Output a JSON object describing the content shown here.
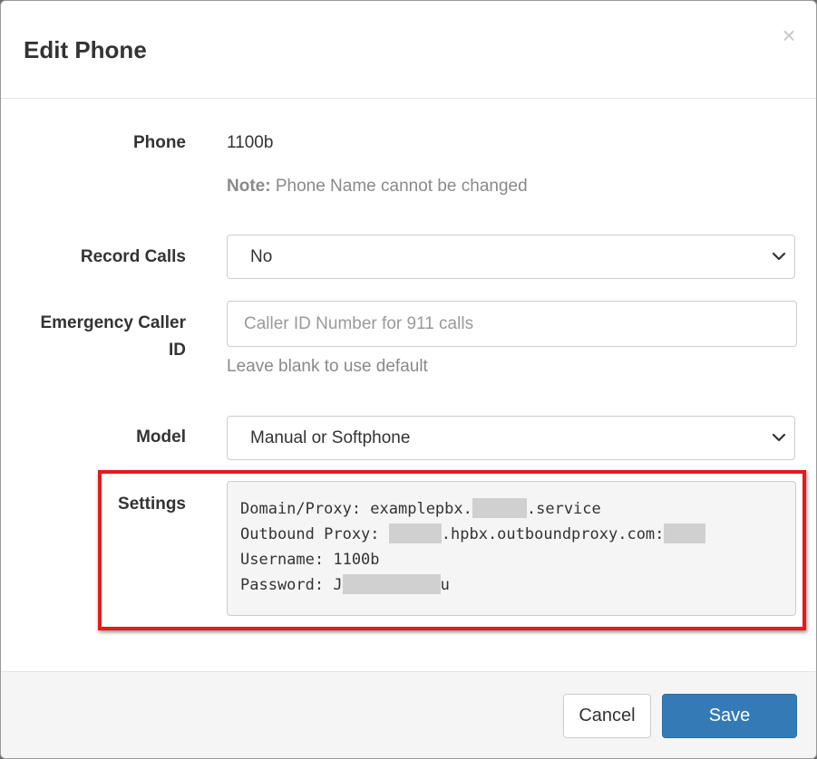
{
  "modal": {
    "title": "Edit Phone",
    "close_symbol": "×"
  },
  "form": {
    "phone": {
      "label": "Phone",
      "value": "1100b",
      "note_strong": "Note:",
      "note_text": " Phone Name cannot be changed"
    },
    "record_calls": {
      "label": "Record Calls",
      "selected": "No"
    },
    "emergency_caller_id": {
      "label_line1": "Emergency Caller",
      "label_line2": "ID",
      "placeholder": "Caller ID Number for 911 calls",
      "value": "",
      "help": "Leave blank to use default"
    },
    "model": {
      "label": "Model",
      "selected": "Manual or Softphone"
    },
    "settings": {
      "label": "Settings",
      "domain_prefix": "Domain/Proxy: examplepbx.",
      "domain_suffix": ".service",
      "outbound_prefix": "Outbound Proxy: ",
      "outbound_middle": ".hpbx.outboundproxy.com:",
      "username_line": "Username: 1100b",
      "password_prefix": "Password: J",
      "password_suffix": "u"
    }
  },
  "footer": {
    "cancel_label": "Cancel",
    "save_label": "Save"
  },
  "colors": {
    "primary": "#337ab7",
    "highlight_border": "#e31b1b",
    "muted_text": "#8a8a8a",
    "redaction": "#d0d0d0"
  },
  "icons": {
    "select_arrow": "chevron-down-icon",
    "close": "close-icon"
  }
}
